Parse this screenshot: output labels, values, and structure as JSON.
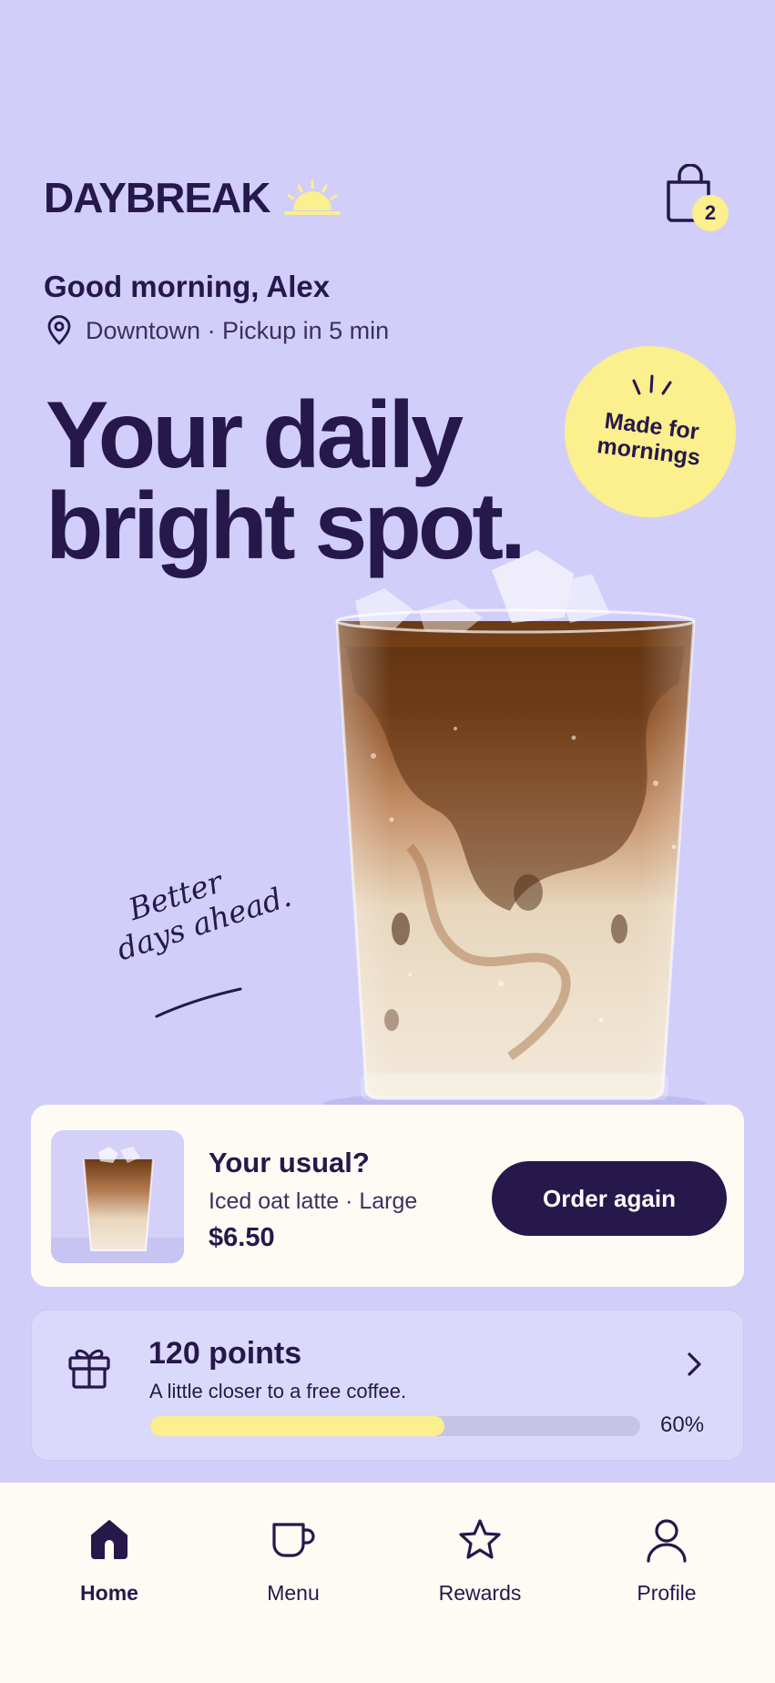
{
  "brand": {
    "name": "DAYBREAK"
  },
  "header": {
    "cart_count": "2"
  },
  "greeting": {
    "text": "Good morning, Alex",
    "location": "Downtown · Pickup in 5 min"
  },
  "hero": {
    "headline_line1": "Your daily",
    "headline_line2": "bright spot.",
    "badge_line1": "Made for",
    "badge_line2": "mornings",
    "tagline_line1": "Better",
    "tagline_line2": "days ahead."
  },
  "usual": {
    "title": "Your usual?",
    "description": "Iced oat latte · Large",
    "price": "$6.50",
    "button_label": "Order again"
  },
  "rewards_card": {
    "points": "120 points",
    "subtitle": "A little closer to a free coffee.",
    "progress_fraction": 0.6,
    "progress_label": "60%"
  },
  "nav": {
    "items": [
      {
        "label": "Home",
        "icon": "home-icon",
        "active": true
      },
      {
        "label": "Menu",
        "icon": "cup-icon",
        "active": false
      },
      {
        "label": "Rewards",
        "icon": "star-icon",
        "active": false
      },
      {
        "label": "Profile",
        "icon": "user-icon",
        "active": false
      }
    ]
  },
  "colors": {
    "background": "#d1cef9",
    "ink": "#26184a",
    "accent_yellow": "#fbef8e",
    "card": "#fdfbf4"
  }
}
